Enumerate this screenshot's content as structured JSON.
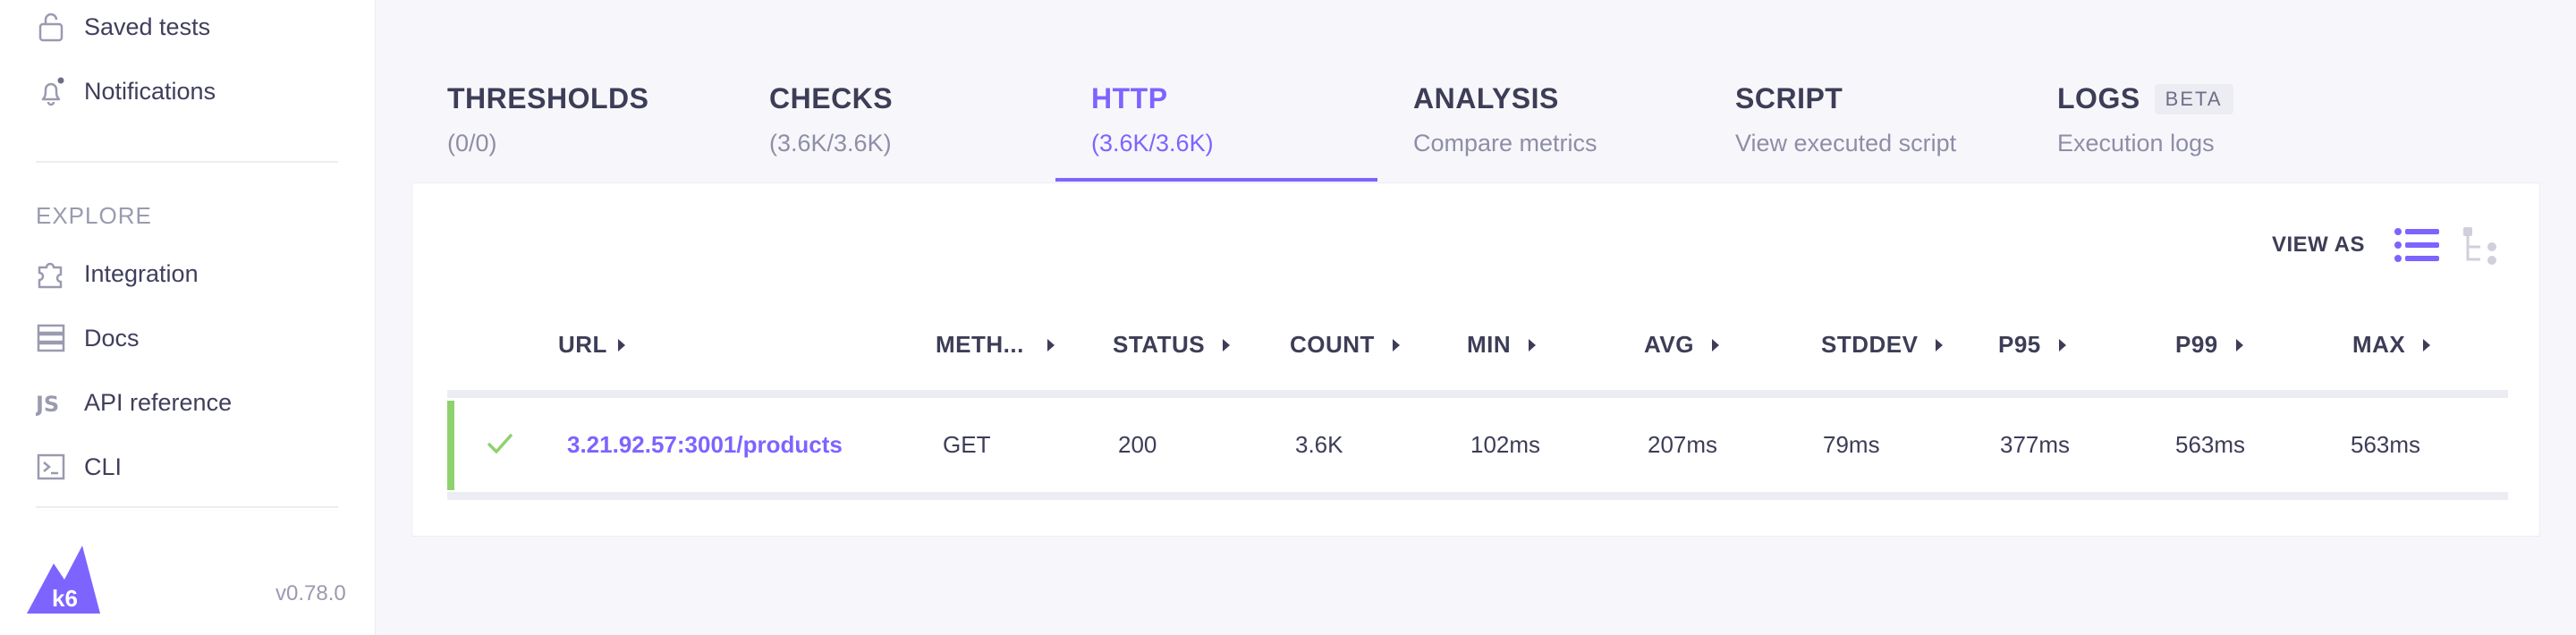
{
  "sidebar": {
    "items": [
      {
        "label": "Saved tests",
        "icon": "lock-icon"
      },
      {
        "label": "Notifications",
        "icon": "bell-icon"
      }
    ],
    "explore_label": "EXPLORE",
    "explore_items": [
      {
        "label": "Integration",
        "icon": "puzzle-icon"
      },
      {
        "label": "Docs",
        "icon": "docs-icon"
      },
      {
        "label": "API reference",
        "icon": "js-icon"
      },
      {
        "label": "CLI",
        "icon": "terminal-icon"
      }
    ],
    "logo_text": "k6",
    "version": "v0.78.0"
  },
  "tabs": [
    {
      "title": "THRESHOLDS",
      "sub": "(0/0)",
      "active": false
    },
    {
      "title": "CHECKS",
      "sub": "(3.6K/3.6K)",
      "active": false
    },
    {
      "title": "HTTP",
      "sub": "(3.6K/3.6K)",
      "active": true
    },
    {
      "title": "ANALYSIS",
      "sub": "Compare metrics",
      "active": false
    },
    {
      "title": "SCRIPT",
      "sub": "View executed script",
      "active": false
    },
    {
      "title": "LOGS",
      "sub": "Execution logs",
      "badge": "BETA",
      "active": false
    }
  ],
  "view_as": "VIEW AS",
  "table": {
    "headers": [
      "URL",
      "METH...",
      "STATUS",
      "COUNT",
      "MIN",
      "AVG",
      "STDDEV",
      "P95",
      "P99",
      "MAX"
    ],
    "rows": [
      {
        "status_icon": "check-icon",
        "url": "3.21.92.57:3001/products",
        "method": "GET",
        "status": "200",
        "count": "3.6K",
        "min": "102ms",
        "avg": "207ms",
        "stddev": "79ms",
        "p95": "377ms",
        "p99": "563ms",
        "max": "563ms"
      }
    ]
  },
  "colors": {
    "accent": "#7d64ff",
    "success": "#8fd16f",
    "text": "#3d3d57",
    "muted": "#8e8ea6"
  }
}
